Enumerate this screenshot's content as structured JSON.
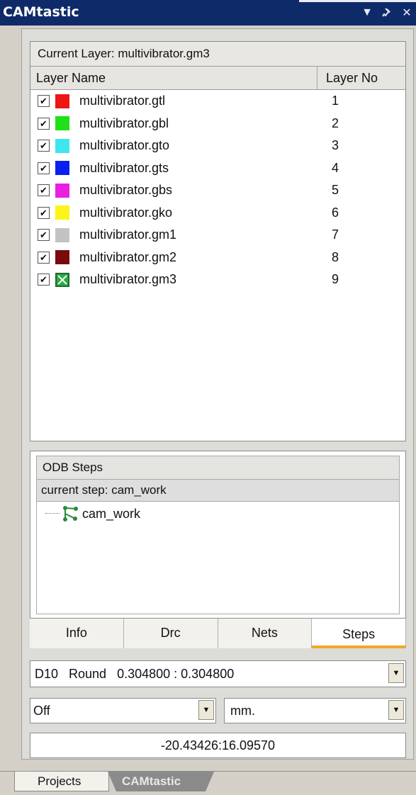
{
  "window": {
    "title": "CAMtastic"
  },
  "layers": {
    "current_layer": "Current Layer: multivibrator.gm3",
    "col_name": "Layer Name",
    "col_no": "Layer No",
    "rows": [
      {
        "name": "multivibrator.gtl",
        "no": "1",
        "color": "#ee1515",
        "checked": true
      },
      {
        "name": "multivibrator.gbl",
        "no": "2",
        "color": "#20e01a",
        "checked": true
      },
      {
        "name": "multivibrator.gto",
        "no": "3",
        "color": "#3fe6f0",
        "checked": true
      },
      {
        "name": "multivibrator.gts",
        "no": "4",
        "color": "#0a1ff0",
        "checked": true
      },
      {
        "name": "multivibrator.gbs",
        "no": "5",
        "color": "#ea1fe0",
        "checked": true
      },
      {
        "name": "multivibrator.gko",
        "no": "6",
        "color": "#fbf51a",
        "checked": true
      },
      {
        "name": "multivibrator.gm1",
        "no": "7",
        "color": "#c2c4c4",
        "checked": true
      },
      {
        "name": "multivibrator.gm2",
        "no": "8",
        "color": "#7a0b0b",
        "checked": true
      },
      {
        "name": "multivibrator.gm3",
        "no": "9",
        "color": "#2ea84a",
        "checked": true
      }
    ]
  },
  "odb": {
    "header": "ODB Steps",
    "current_step": "current step: cam_work",
    "step_item": "cam_work"
  },
  "tabs": [
    {
      "label": "Info",
      "active": false
    },
    {
      "label": "Drc",
      "active": false
    },
    {
      "label": "Nets",
      "active": false
    },
    {
      "label": "Steps",
      "active": true
    }
  ],
  "aperture": {
    "value": "D10   Round   0.304800 : 0.304800"
  },
  "mode": {
    "value": "Off"
  },
  "units": {
    "value": "mm."
  },
  "coords": {
    "value": "-20.43426:16.09570"
  },
  "bottom_tabs": [
    "Projects",
    "CAMtastic"
  ],
  "colors": {
    "titlebar": "#0f2a69",
    "active_tab_accent": "#f0a828"
  }
}
